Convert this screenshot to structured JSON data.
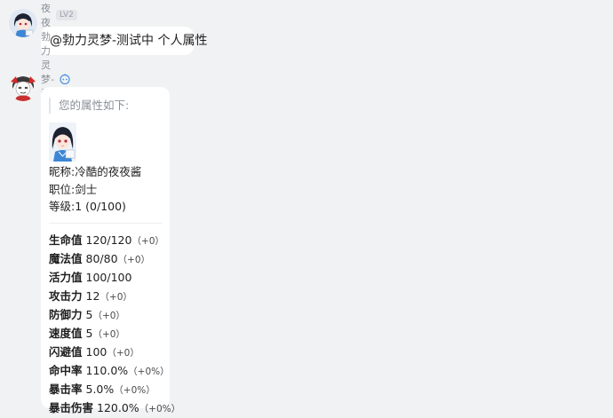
{
  "messages": [
    {
      "sender": "夜夜",
      "level": "LV2",
      "text": "@勃力灵梦-测试中 个人属性"
    },
    {
      "sender": "勃力灵梦-测试中",
      "bot_icon": "bot-icon",
      "quote": "您的属性如下:",
      "info": [
        {
          "label": "昵称:",
          "value": "冷酷的夜夜酱"
        },
        {
          "label": "职位:",
          "value": "剑士"
        },
        {
          "label": "等级:",
          "value": "1 (0/100)"
        }
      ],
      "stats": [
        {
          "name": "生命值",
          "value": "120/120",
          "delta": "（+0）"
        },
        {
          "name": "魔法值",
          "value": "80/80",
          "delta": "（+0）"
        },
        {
          "name": "活力值",
          "value": "100/100",
          "delta": ""
        },
        {
          "name": "攻击力",
          "value": "12",
          "delta": "（+0）"
        },
        {
          "name": "防御力",
          "value": "5",
          "delta": "（+0）"
        },
        {
          "name": "速度值",
          "value": "5",
          "delta": "（+0）"
        },
        {
          "name": "闪避值",
          "value": "100",
          "delta": "（+0）"
        },
        {
          "name": "命中率",
          "value": "110.0%",
          "delta": "（+0%）"
        },
        {
          "name": "暴击率",
          "value": "5.0%",
          "delta": "（+0%）"
        },
        {
          "name": "暴击伤害",
          "value": "120.0%",
          "delta": "（+0%）"
        }
      ]
    }
  ],
  "colors": {
    "background": "#f1f2f3",
    "bubble": "#ffffff",
    "muted": "#8a8f98",
    "bot_accent": "#4a90e2"
  }
}
